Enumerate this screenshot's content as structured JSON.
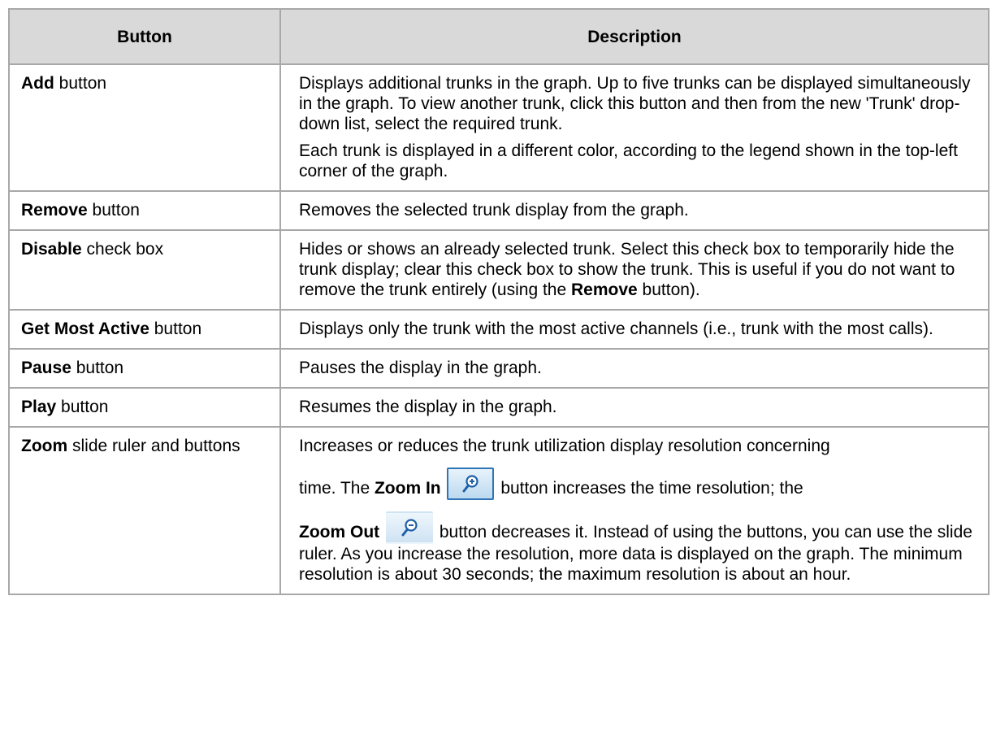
{
  "table": {
    "header": {
      "col1": "Button",
      "col2": "Description"
    },
    "rows": [
      {
        "term": "Add",
        "term_suffix": " button",
        "desc_p1": "Displays additional trunks in the graph. Up to five trunks can be displayed simultaneously in the graph. To view another trunk, click this button and then from the new 'Trunk' drop-down list, select the required trunk.",
        "desc_p2": "Each trunk is displayed in a different color, according to the legend shown in the top-left corner of the graph."
      },
      {
        "term": "Remove",
        "term_suffix": " button",
        "desc": "Removes the selected trunk display from the graph."
      },
      {
        "term": "Disable",
        "term_suffix": " check box",
        "desc_pre": "Hides or shows an already selected trunk. Select this check box to temporarily hide the trunk display; clear this check box to show the trunk. This is useful if you do not want to remove the trunk entirely (using the ",
        "desc_bold": "Remove",
        "desc_post": " button)."
      },
      {
        "term": "Get Most Active",
        "term_suffix": " button",
        "desc": "Displays only the trunk with the most active channels (i.e., trunk with the most calls)."
      },
      {
        "term": "Pause",
        "term_suffix": " button",
        "desc": "Pauses the display in the graph."
      },
      {
        "term": "Play",
        "term_suffix": " button",
        "desc": "Resumes the display in the graph."
      },
      {
        "term": "Zoom",
        "term_suffix": " slide ruler and buttons",
        "desc_line1": "Increases or reduces the trunk utilization display resolution concerning",
        "desc_time": "time. The ",
        "zoom_in_label": "Zoom In",
        "zoom_in_after": " button increases the time resolution; the",
        "zoom_out_label": "Zoom Out",
        "zoom_out_after": " button decreases it. Instead of using the buttons, you can use the slide ruler. As you increase the resolution, more data is displayed on the graph. The minimum resolution is about 30 seconds; the maximum resolution is about an hour."
      }
    ]
  },
  "icons": {
    "zoom_in": "zoom-in-icon",
    "zoom_out": "zoom-out-icon"
  },
  "colors": {
    "header_bg": "#d9d9d9",
    "border": "#a8a8a8",
    "zoom_button_border": "#2e75b6"
  }
}
